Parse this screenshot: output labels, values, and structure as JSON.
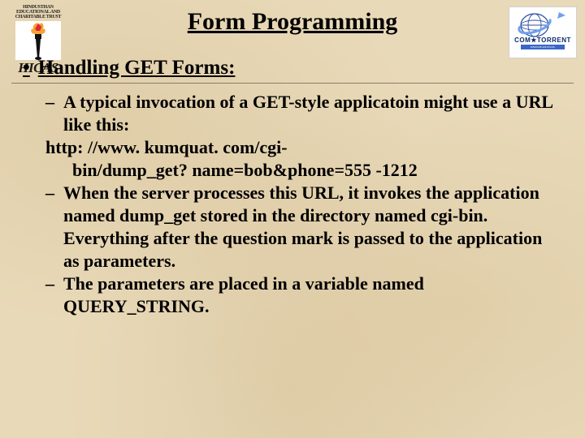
{
  "logos": {
    "left": {
      "line1": "HINDUSTHAN",
      "line2": "EDUCATIONAL AND",
      "line3": "CHARITABLE TRUST",
      "name": "HICAS"
    },
    "right": {
      "brand": "COM★TORRENT",
      "tagline": "INNOVATE AND EXCEL"
    }
  },
  "title": "Form Programming",
  "heading": "Handling GET Forms:",
  "items": {
    "i1": "A typical invocation of a GET-style applicatoin might use a URL like this:",
    "http": "http: //www. kumquat. com/cgi-\n      bin/dump_get? name=bob&phone=555 -1212",
    "i2": "When the server processes this URL, it invokes the application named dump_get stored in the directory named cgi-bin.  Everything after the question mark is passed to the application as parameters.",
    "i3": "The parameters are placed in a variable named QUERY_STRING."
  }
}
